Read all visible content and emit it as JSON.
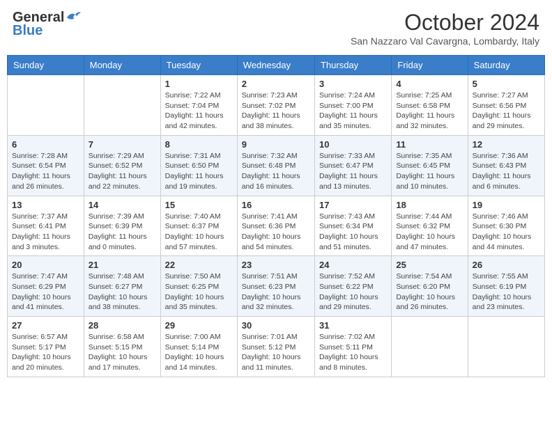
{
  "header": {
    "logo_general": "General",
    "logo_blue": "Blue",
    "month_title": "October 2024",
    "location": "San Nazzaro Val Cavargna, Lombardy, Italy"
  },
  "days_of_week": [
    "Sunday",
    "Monday",
    "Tuesday",
    "Wednesday",
    "Thursday",
    "Friday",
    "Saturday"
  ],
  "weeks": [
    [
      {
        "day": "",
        "sunrise": "",
        "sunset": "",
        "daylight": ""
      },
      {
        "day": "",
        "sunrise": "",
        "sunset": "",
        "daylight": ""
      },
      {
        "day": "1",
        "sunrise": "Sunrise: 7:22 AM",
        "sunset": "Sunset: 7:04 PM",
        "daylight": "Daylight: 11 hours and 42 minutes."
      },
      {
        "day": "2",
        "sunrise": "Sunrise: 7:23 AM",
        "sunset": "Sunset: 7:02 PM",
        "daylight": "Daylight: 11 hours and 38 minutes."
      },
      {
        "day": "3",
        "sunrise": "Sunrise: 7:24 AM",
        "sunset": "Sunset: 7:00 PM",
        "daylight": "Daylight: 11 hours and 35 minutes."
      },
      {
        "day": "4",
        "sunrise": "Sunrise: 7:25 AM",
        "sunset": "Sunset: 6:58 PM",
        "daylight": "Daylight: 11 hours and 32 minutes."
      },
      {
        "day": "5",
        "sunrise": "Sunrise: 7:27 AM",
        "sunset": "Sunset: 6:56 PM",
        "daylight": "Daylight: 11 hours and 29 minutes."
      }
    ],
    [
      {
        "day": "6",
        "sunrise": "Sunrise: 7:28 AM",
        "sunset": "Sunset: 6:54 PM",
        "daylight": "Daylight: 11 hours and 26 minutes."
      },
      {
        "day": "7",
        "sunrise": "Sunrise: 7:29 AM",
        "sunset": "Sunset: 6:52 PM",
        "daylight": "Daylight: 11 hours and 22 minutes."
      },
      {
        "day": "8",
        "sunrise": "Sunrise: 7:31 AM",
        "sunset": "Sunset: 6:50 PM",
        "daylight": "Daylight: 11 hours and 19 minutes."
      },
      {
        "day": "9",
        "sunrise": "Sunrise: 7:32 AM",
        "sunset": "Sunset: 6:48 PM",
        "daylight": "Daylight: 11 hours and 16 minutes."
      },
      {
        "day": "10",
        "sunrise": "Sunrise: 7:33 AM",
        "sunset": "Sunset: 6:47 PM",
        "daylight": "Daylight: 11 hours and 13 minutes."
      },
      {
        "day": "11",
        "sunrise": "Sunrise: 7:35 AM",
        "sunset": "Sunset: 6:45 PM",
        "daylight": "Daylight: 11 hours and 10 minutes."
      },
      {
        "day": "12",
        "sunrise": "Sunrise: 7:36 AM",
        "sunset": "Sunset: 6:43 PM",
        "daylight": "Daylight: 11 hours and 6 minutes."
      }
    ],
    [
      {
        "day": "13",
        "sunrise": "Sunrise: 7:37 AM",
        "sunset": "Sunset: 6:41 PM",
        "daylight": "Daylight: 11 hours and 3 minutes."
      },
      {
        "day": "14",
        "sunrise": "Sunrise: 7:39 AM",
        "sunset": "Sunset: 6:39 PM",
        "daylight": "Daylight: 11 hours and 0 minutes."
      },
      {
        "day": "15",
        "sunrise": "Sunrise: 7:40 AM",
        "sunset": "Sunset: 6:37 PM",
        "daylight": "Daylight: 10 hours and 57 minutes."
      },
      {
        "day": "16",
        "sunrise": "Sunrise: 7:41 AM",
        "sunset": "Sunset: 6:36 PM",
        "daylight": "Daylight: 10 hours and 54 minutes."
      },
      {
        "day": "17",
        "sunrise": "Sunrise: 7:43 AM",
        "sunset": "Sunset: 6:34 PM",
        "daylight": "Daylight: 10 hours and 51 minutes."
      },
      {
        "day": "18",
        "sunrise": "Sunrise: 7:44 AM",
        "sunset": "Sunset: 6:32 PM",
        "daylight": "Daylight: 10 hours and 47 minutes."
      },
      {
        "day": "19",
        "sunrise": "Sunrise: 7:46 AM",
        "sunset": "Sunset: 6:30 PM",
        "daylight": "Daylight: 10 hours and 44 minutes."
      }
    ],
    [
      {
        "day": "20",
        "sunrise": "Sunrise: 7:47 AM",
        "sunset": "Sunset: 6:29 PM",
        "daylight": "Daylight: 10 hours and 41 minutes."
      },
      {
        "day": "21",
        "sunrise": "Sunrise: 7:48 AM",
        "sunset": "Sunset: 6:27 PM",
        "daylight": "Daylight: 10 hours and 38 minutes."
      },
      {
        "day": "22",
        "sunrise": "Sunrise: 7:50 AM",
        "sunset": "Sunset: 6:25 PM",
        "daylight": "Daylight: 10 hours and 35 minutes."
      },
      {
        "day": "23",
        "sunrise": "Sunrise: 7:51 AM",
        "sunset": "Sunset: 6:23 PM",
        "daylight": "Daylight: 10 hours and 32 minutes."
      },
      {
        "day": "24",
        "sunrise": "Sunrise: 7:52 AM",
        "sunset": "Sunset: 6:22 PM",
        "daylight": "Daylight: 10 hours and 29 minutes."
      },
      {
        "day": "25",
        "sunrise": "Sunrise: 7:54 AM",
        "sunset": "Sunset: 6:20 PM",
        "daylight": "Daylight: 10 hours and 26 minutes."
      },
      {
        "day": "26",
        "sunrise": "Sunrise: 7:55 AM",
        "sunset": "Sunset: 6:19 PM",
        "daylight": "Daylight: 10 hours and 23 minutes."
      }
    ],
    [
      {
        "day": "27",
        "sunrise": "Sunrise: 6:57 AM",
        "sunset": "Sunset: 5:17 PM",
        "daylight": "Daylight: 10 hours and 20 minutes."
      },
      {
        "day": "28",
        "sunrise": "Sunrise: 6:58 AM",
        "sunset": "Sunset: 5:15 PM",
        "daylight": "Daylight: 10 hours and 17 minutes."
      },
      {
        "day": "29",
        "sunrise": "Sunrise: 7:00 AM",
        "sunset": "Sunset: 5:14 PM",
        "daylight": "Daylight: 10 hours and 14 minutes."
      },
      {
        "day": "30",
        "sunrise": "Sunrise: 7:01 AM",
        "sunset": "Sunset: 5:12 PM",
        "daylight": "Daylight: 10 hours and 11 minutes."
      },
      {
        "day": "31",
        "sunrise": "Sunrise: 7:02 AM",
        "sunset": "Sunset: 5:11 PM",
        "daylight": "Daylight: 10 hours and 8 minutes."
      },
      {
        "day": "",
        "sunrise": "",
        "sunset": "",
        "daylight": ""
      },
      {
        "day": "",
        "sunrise": "",
        "sunset": "",
        "daylight": ""
      }
    ]
  ]
}
